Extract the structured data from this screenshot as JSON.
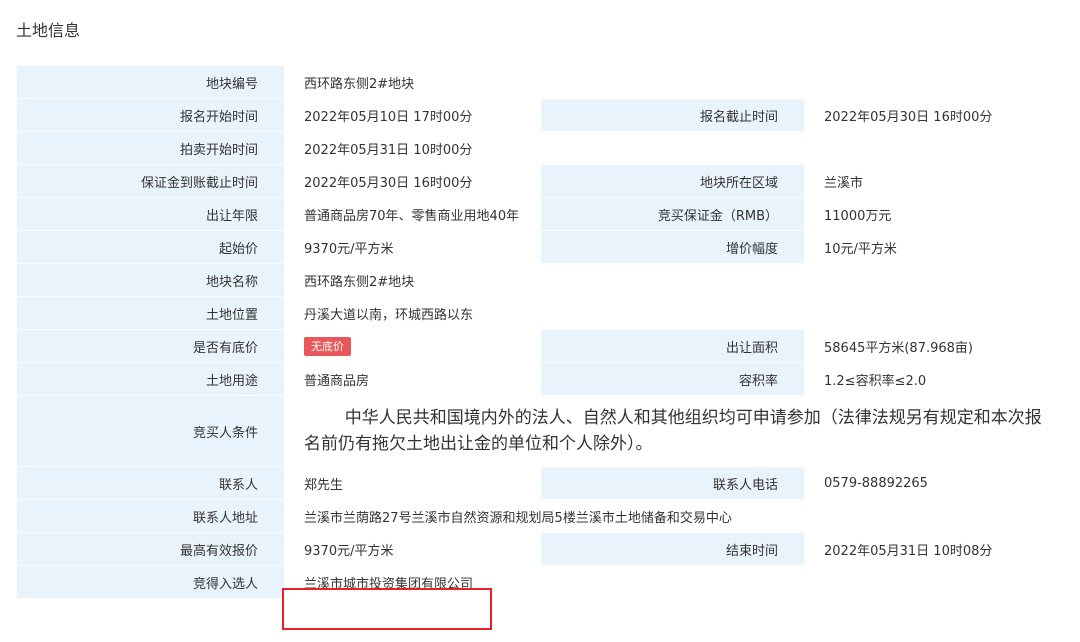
{
  "page": {
    "title": "土地信息"
  },
  "colors": {
    "label_bg": "#e9f3fb",
    "badge_bg": "#e8585a",
    "highlight": "#e8202a"
  },
  "rows": {
    "r1": {
      "label": "地块编号",
      "value": "西环路东侧2#地块"
    },
    "r2": {
      "label": "报名开始时间",
      "value": "2022年05月10日 17时00分",
      "label2": "报名截止时间",
      "value2": "2022年05月30日 16时00分"
    },
    "r3": {
      "label": "拍卖开始时间",
      "value": "2022年05月31日 10时00分"
    },
    "r4": {
      "label": "保证金到账截止时间",
      "value": "2022年05月30日 16时00分",
      "label2": "地块所在区域",
      "value2": "兰溪市"
    },
    "r5": {
      "label": "出让年限",
      "value": "普通商品房70年、零售商业用地40年",
      "label2": "竞买保证金（RMB）",
      "value2": "11000万元"
    },
    "r6": {
      "label": "起始价",
      "value": "9370元/平方米",
      "label2": "增价幅度",
      "value2": "10元/平方米"
    },
    "r7": {
      "label": "地块名称",
      "value": "西环路东侧2#地块"
    },
    "r8": {
      "label": "土地位置",
      "value": "丹溪大道以南，环城西路以东"
    },
    "r9": {
      "label": "是否有底价",
      "badge": "无底价",
      "label2": "出让面积",
      "value2": "58645平方米(87.968亩)"
    },
    "r10": {
      "label": "土地用途",
      "value": "普通商品房",
      "label2": "容积率",
      "value2": "1.2≤容积率≤2.0"
    },
    "r11": {
      "label": "竞买人条件",
      "value": "中华人民共和国境内外的法人、自然人和其他组织均可申请参加（法律法规另有规定和本次报名前仍有拖欠土地出让金的单位和个人除外）。"
    },
    "r12": {
      "label": "联系人",
      "value": "郑先生",
      "label2": "联系人电话",
      "value2": "0579-88892265"
    },
    "r13": {
      "label": "联系人地址",
      "value": "兰溪市兰荫路27号兰溪市自然资源和规划局5楼兰溪市土地储备和交易中心"
    },
    "r14": {
      "label": "最高有效报价",
      "value": "9370元/平方米",
      "label2": "结束时间",
      "value2": "2022年05月31日 10时08分"
    },
    "r15": {
      "label": "竞得入选人",
      "value": "兰溪市城市投资集团有限公司"
    }
  }
}
